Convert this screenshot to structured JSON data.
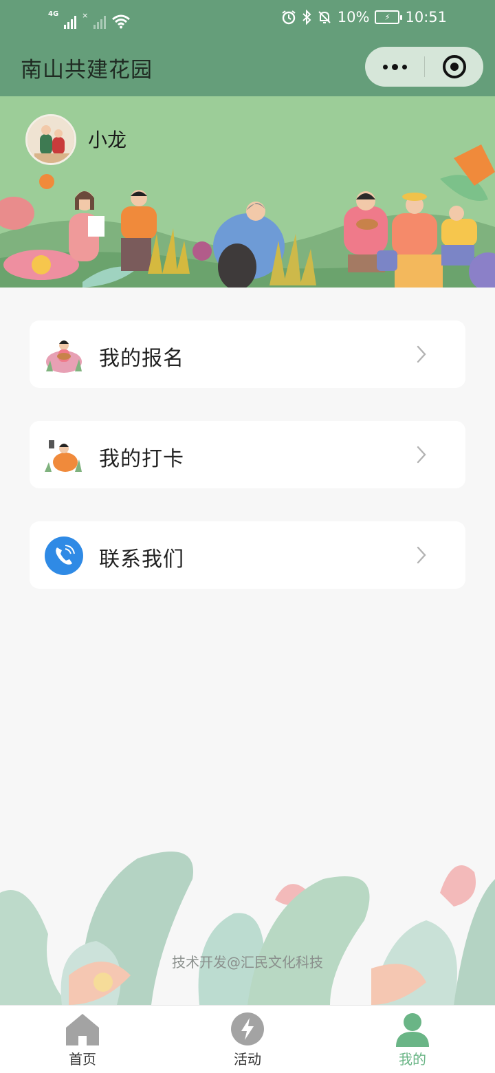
{
  "status_bar": {
    "network": "4G",
    "battery": "10%",
    "time": "10:51"
  },
  "nav": {
    "title": "南山共建花园"
  },
  "profile": {
    "username": "小龙"
  },
  "menu": [
    {
      "label": "我的报名",
      "icon": "registration-illustration-icon"
    },
    {
      "label": "我的打卡",
      "icon": "checkin-illustration-icon"
    },
    {
      "label": "联系我们",
      "icon": "phone-icon"
    }
  ],
  "footer": {
    "credit": "技术开发@汇民文化科技"
  },
  "tabs": [
    {
      "label": "首页",
      "icon": "home-icon",
      "active": false
    },
    {
      "label": "活动",
      "icon": "lightning-icon",
      "active": false
    },
    {
      "label": "我的",
      "icon": "user-icon",
      "active": true
    }
  ],
  "colors": {
    "header_green": "#659e7a",
    "banner_green": "#9ccd98",
    "active_tab": "#6ab586",
    "phone_blue": "#2f8ae5"
  }
}
